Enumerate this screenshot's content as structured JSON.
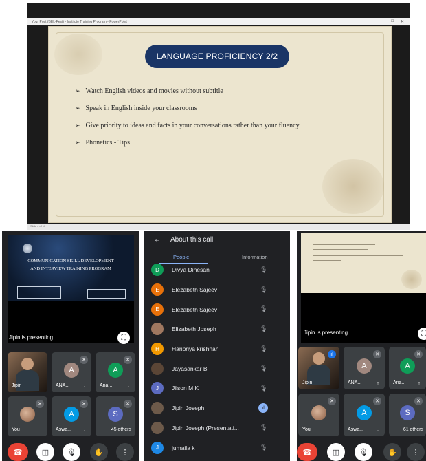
{
  "top_window": {
    "titlebar_text": "Your Post (BEL-Fest) - Institute Training Program - PowerPoint",
    "window_controls": [
      "–",
      "□",
      "✕"
    ],
    "status_text": "Slide 4 of 10"
  },
  "slide": {
    "title": "LANGUAGE PROFICIENCY 2/2",
    "bullet_icon": "➢",
    "bullets": [
      "Watch English videos and movies without subtitle",
      "Speak in English inside your classrooms",
      "Give priority to ideas and facts in your conversations rather than your fluency",
      "Phonetics - Tips"
    ]
  },
  "left_panel": {
    "presentation_title_line1": "COMMUNICATION SKILL DEVELOPMENT",
    "presentation_title_line2": "AND INTERVIEW TRAINING PROGRAM",
    "presenting_label": "Jipin is presenting",
    "tiles": [
      {
        "name": "Jipin",
        "initial": "",
        "color": ""
      },
      {
        "name": "ANA...",
        "initial": "A",
        "color": "#a1887f"
      },
      {
        "name": "Ana...",
        "initial": "A",
        "color": "#0f9d58"
      },
      {
        "name": "You",
        "initial": "",
        "color": ""
      },
      {
        "name": "Aswa...",
        "initial": "A",
        "color": "#039be5"
      },
      {
        "name": "45 others",
        "initial": "S",
        "color": "#5c6bc0"
      }
    ]
  },
  "middle_panel": {
    "title": "About this call",
    "tab_people": "People",
    "tab_information": "Information",
    "people": [
      {
        "name": "Divya Dinesan",
        "initial": "D",
        "color": "#0f9d58",
        "speaking": false
      },
      {
        "name": "Elezabeth Sajeev",
        "initial": "E",
        "color": "#e8710a",
        "speaking": false
      },
      {
        "name": "Elezabeth Sajeev",
        "initial": "E",
        "color": "#e8710a",
        "speaking": false
      },
      {
        "name": "Elizabeth Joseph",
        "initial": "",
        "color": "#a07860",
        "speaking": false
      },
      {
        "name": "Haripriya krishnan",
        "initial": "H",
        "color": "#f29900",
        "speaking": false
      },
      {
        "name": "Jayasankar B",
        "initial": "",
        "color": "#5b4636",
        "speaking": false
      },
      {
        "name": "Jilson M K",
        "initial": "J",
        "color": "#5c6bc0",
        "speaking": false
      },
      {
        "name": "Jipin Joseph",
        "initial": "",
        "color": "#6d5a4a",
        "speaking": true
      },
      {
        "name": "Jipin Joseph (Presentati...",
        "initial": "",
        "color": "#6d5a4a",
        "speaking": false
      },
      {
        "name": "jumaila k",
        "initial": "J",
        "color": "#1e88e5",
        "speaking": false
      }
    ]
  },
  "right_panel": {
    "presenting_label": "Jipin is presenting",
    "tiles": [
      {
        "name": "Jipin",
        "initial": "",
        "color": ""
      },
      {
        "name": "ANA...",
        "initial": "A",
        "color": "#a1887f"
      },
      {
        "name": "Ana...",
        "initial": "A",
        "color": "#0f9d58"
      },
      {
        "name": "You",
        "initial": "",
        "color": ""
      },
      {
        "name": "Aswa...",
        "initial": "A",
        "color": "#039be5"
      },
      {
        "name": "61 others",
        "initial": "S",
        "color": "#5c6bc0"
      }
    ]
  },
  "icons": {
    "mic_off": "🎙",
    "more": "⋮",
    "back": "←",
    "fullscreen": "⛶",
    "end_call": "☎",
    "cam_off": "◫",
    "hand": "✋",
    "speaking": "ıl"
  }
}
